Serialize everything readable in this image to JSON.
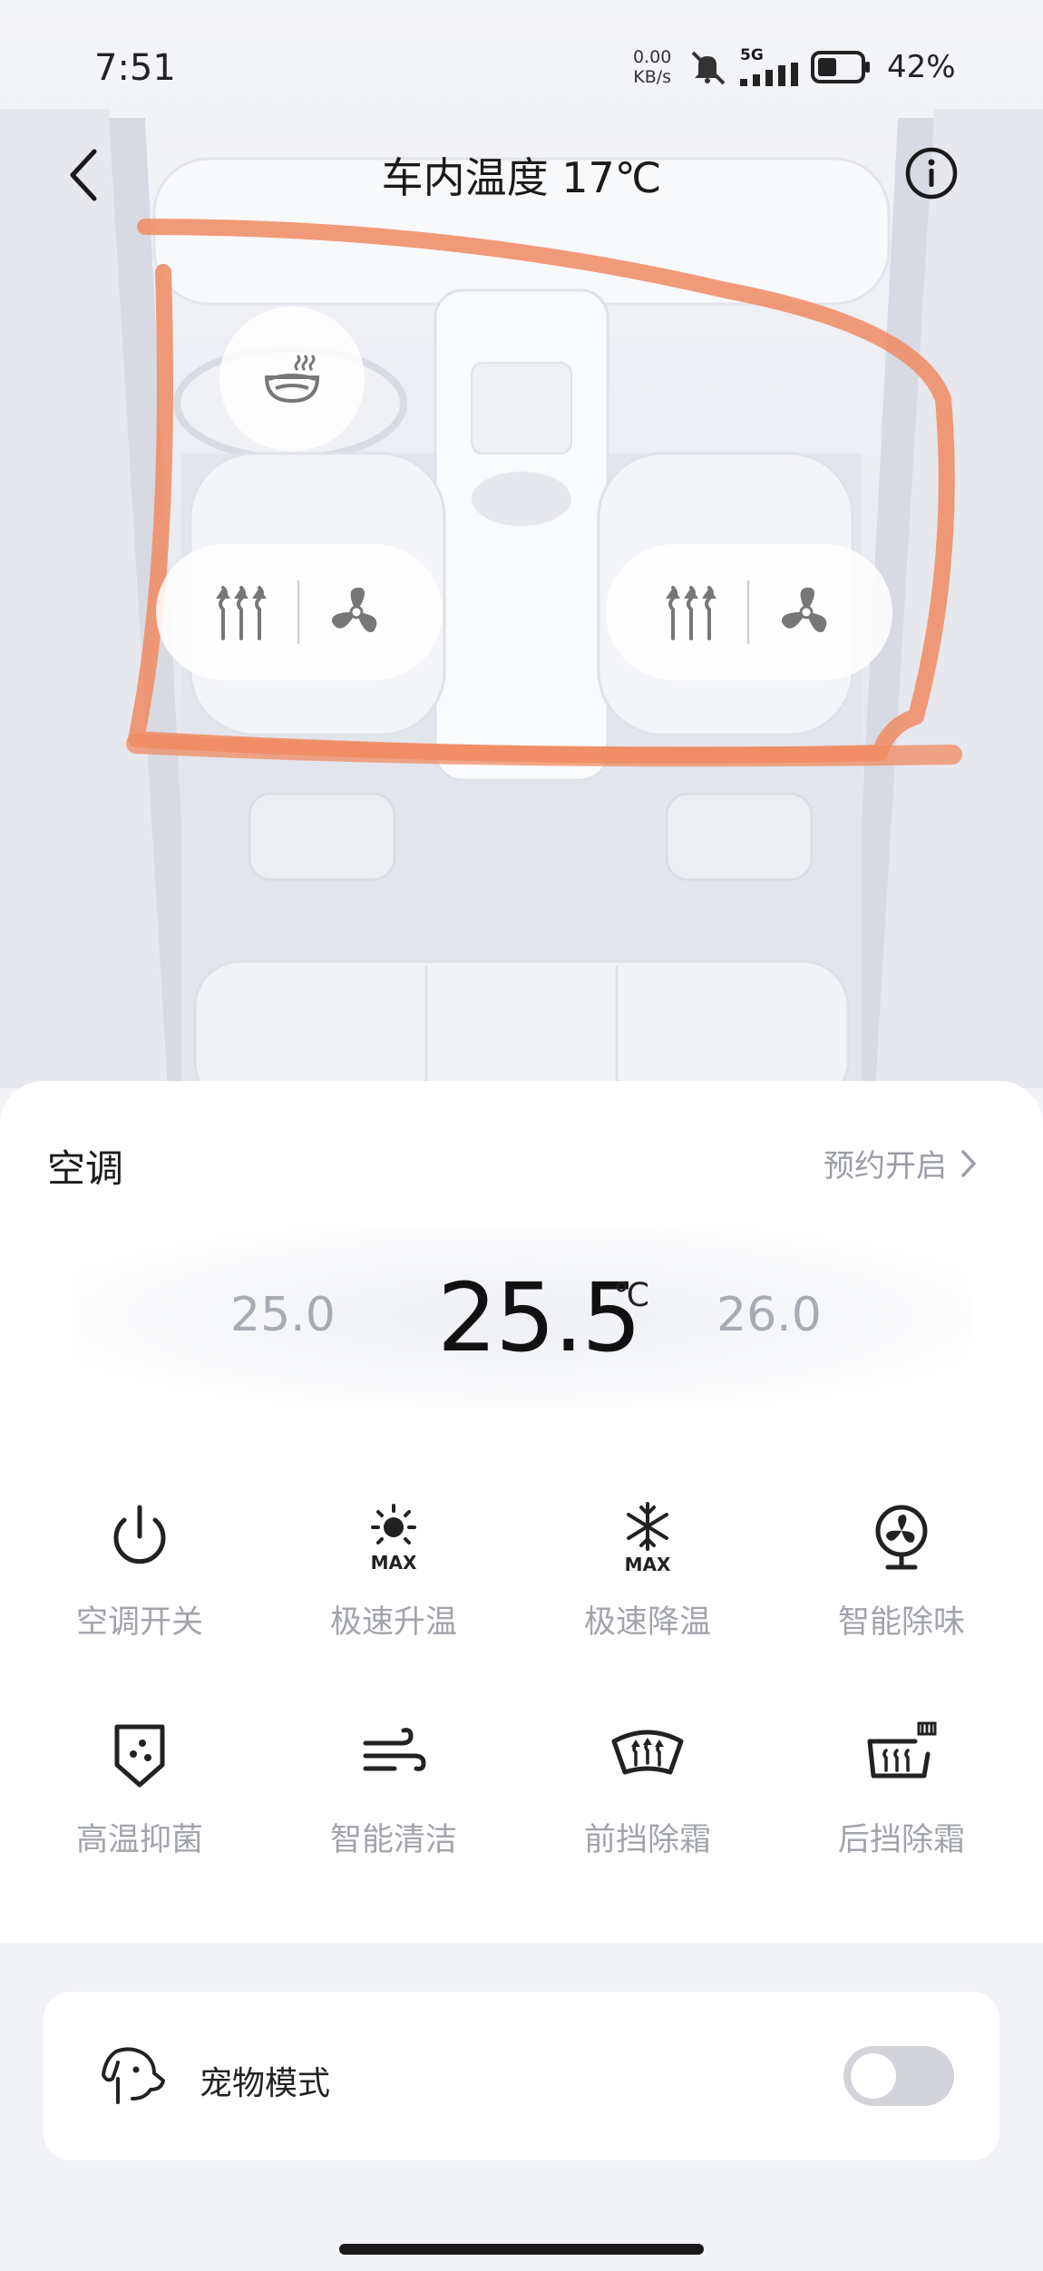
{
  "status_bar": {
    "time": "7:51",
    "net_speed_value": "0.00",
    "net_speed_unit": "KB/s",
    "network": "5G",
    "battery": "42%"
  },
  "header": {
    "title": "车内温度 17℃"
  },
  "icons": {
    "back": "back-chevron-icon",
    "info": "info-icon",
    "steering_heat": "steering-wheel-heat-icon",
    "seat_heat": "seat-heat-icon",
    "seat_vent": "fan-icon",
    "pet": "dog-icon"
  },
  "ac": {
    "title": "空调",
    "schedule_label": "预约开启",
    "temp_lower": "25.0",
    "temp_current": "25.5",
    "temp_unit": "℃",
    "temp_higher": "26.0"
  },
  "functions": [
    {
      "label": "空调开关",
      "icon": "power-icon"
    },
    {
      "label": "极速升温",
      "icon": "sun-max-icon"
    },
    {
      "label": "极速降温",
      "icon": "snowflake-max-icon"
    },
    {
      "label": "智能除味",
      "icon": "fan-purify-icon"
    },
    {
      "label": "高温抑菌",
      "icon": "shield-sterilize-icon"
    },
    {
      "label": "智能清洁",
      "icon": "wind-clean-icon"
    },
    {
      "label": "前挡除霜",
      "icon": "front-defrost-icon"
    },
    {
      "label": "后挡除霜",
      "icon": "rear-defrost-icon"
    }
  ],
  "pet_mode": {
    "label": "宠物模式",
    "enabled": false
  },
  "colors": {
    "annotation_stroke": "#f08a62",
    "muted_text": "#a1a4aa",
    "toggle_off": "#d2d4d9"
  }
}
